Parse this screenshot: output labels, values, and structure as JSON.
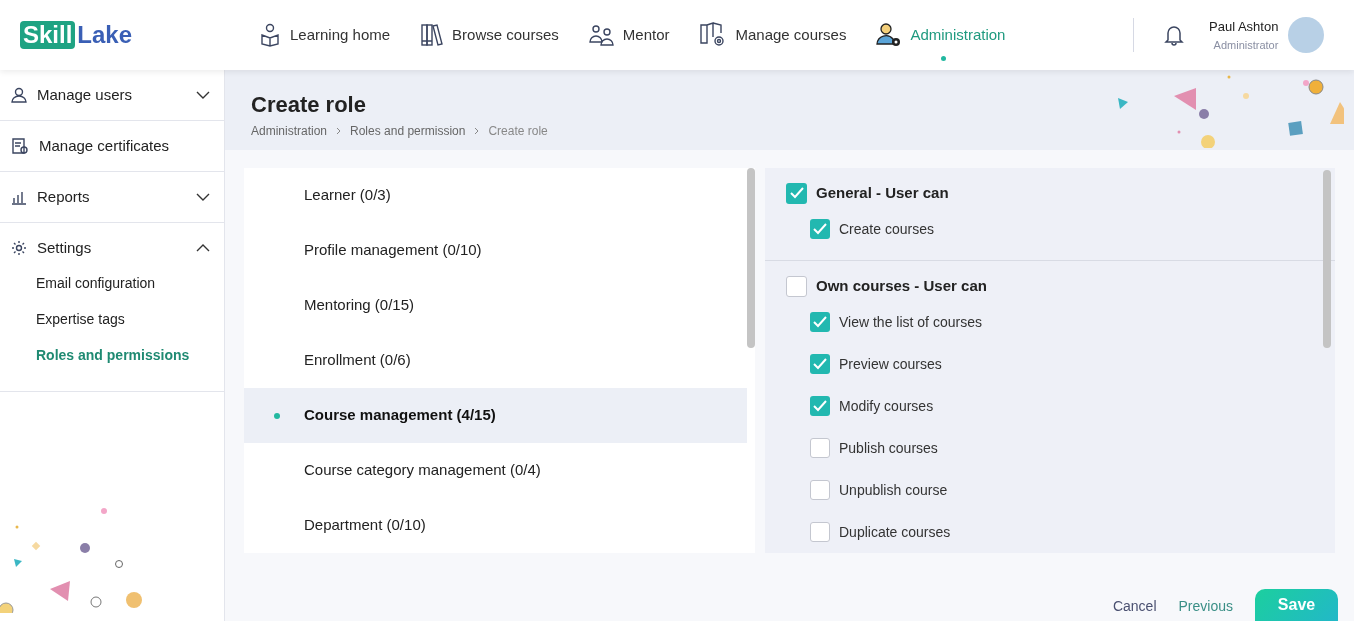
{
  "logo": {
    "part_1": "Skill",
    "part_2": "Lake"
  },
  "nav": [
    {
      "label": "Learning home",
      "selected": false
    },
    {
      "label": "Browse courses",
      "selected": false
    },
    {
      "label": "Mentor",
      "selected": false
    },
    {
      "label": "Manage courses",
      "selected": false
    },
    {
      "label": "Administration",
      "selected": true
    }
  ],
  "user": {
    "name": "Paul Ashton",
    "role": "Administrator"
  },
  "sidebar": {
    "items": [
      {
        "label": "Manage users",
        "expanded": false
      },
      {
        "label": "Manage certificates"
      },
      {
        "label": "Reports",
        "expanded": false
      },
      {
        "label": "Settings",
        "expanded": true,
        "children": [
          {
            "label": "Email configuration",
            "selected": false
          },
          {
            "label": "Expertise tags",
            "selected": false
          },
          {
            "label": "Roles and permissions",
            "selected": true
          }
        ]
      }
    ]
  },
  "page": {
    "title": "Create role",
    "breadcrumb": [
      "Administration",
      "Roles and permission",
      "Create role"
    ]
  },
  "categories": [
    {
      "label": "Learner (0/3)",
      "selected": false
    },
    {
      "label": "Profile management (0/10)",
      "selected": false
    },
    {
      "label": "Mentoring (0/15)",
      "selected": false
    },
    {
      "label": "Enrollment (0/6)",
      "selected": false
    },
    {
      "label": "Course management (4/15)",
      "selected": true
    },
    {
      "label": "Course category management (0/4)",
      "selected": false
    },
    {
      "label": "Department (0/10)",
      "selected": false
    }
  ],
  "permission_groups": [
    {
      "label": "General - User can",
      "checked": true,
      "children": [
        {
          "label": "Create courses",
          "checked": true
        }
      ]
    },
    {
      "label": "Own courses - User can",
      "checked": false,
      "children": [
        {
          "label": "View the list of courses",
          "checked": true
        },
        {
          "label": "Preview courses",
          "checked": true
        },
        {
          "label": "Modify courses",
          "checked": true
        },
        {
          "label": "Publish courses",
          "checked": false
        },
        {
          "label": "Unpublish course",
          "checked": false
        },
        {
          "label": "Duplicate courses",
          "checked": false
        }
      ]
    }
  ],
  "footer": {
    "cancel": "Cancel",
    "previous": "Previous",
    "save": "Save"
  }
}
